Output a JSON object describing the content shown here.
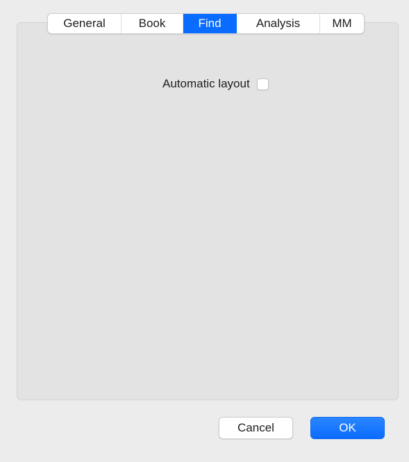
{
  "tabs": [
    {
      "label": "General",
      "selected": false
    },
    {
      "label": "Book",
      "selected": false
    },
    {
      "label": "Find",
      "selected": true
    },
    {
      "label": "Analysis",
      "selected": false
    },
    {
      "label": "MM",
      "selected": false
    }
  ],
  "options": {
    "automatic_layout": {
      "label": "Automatic layout",
      "checked": false
    }
  },
  "buttons": {
    "cancel": "Cancel",
    "ok": "OK"
  },
  "colors": {
    "accent": "#0a6cff",
    "window_bg": "#ececec",
    "panel_bg": "#e3e3e3"
  }
}
